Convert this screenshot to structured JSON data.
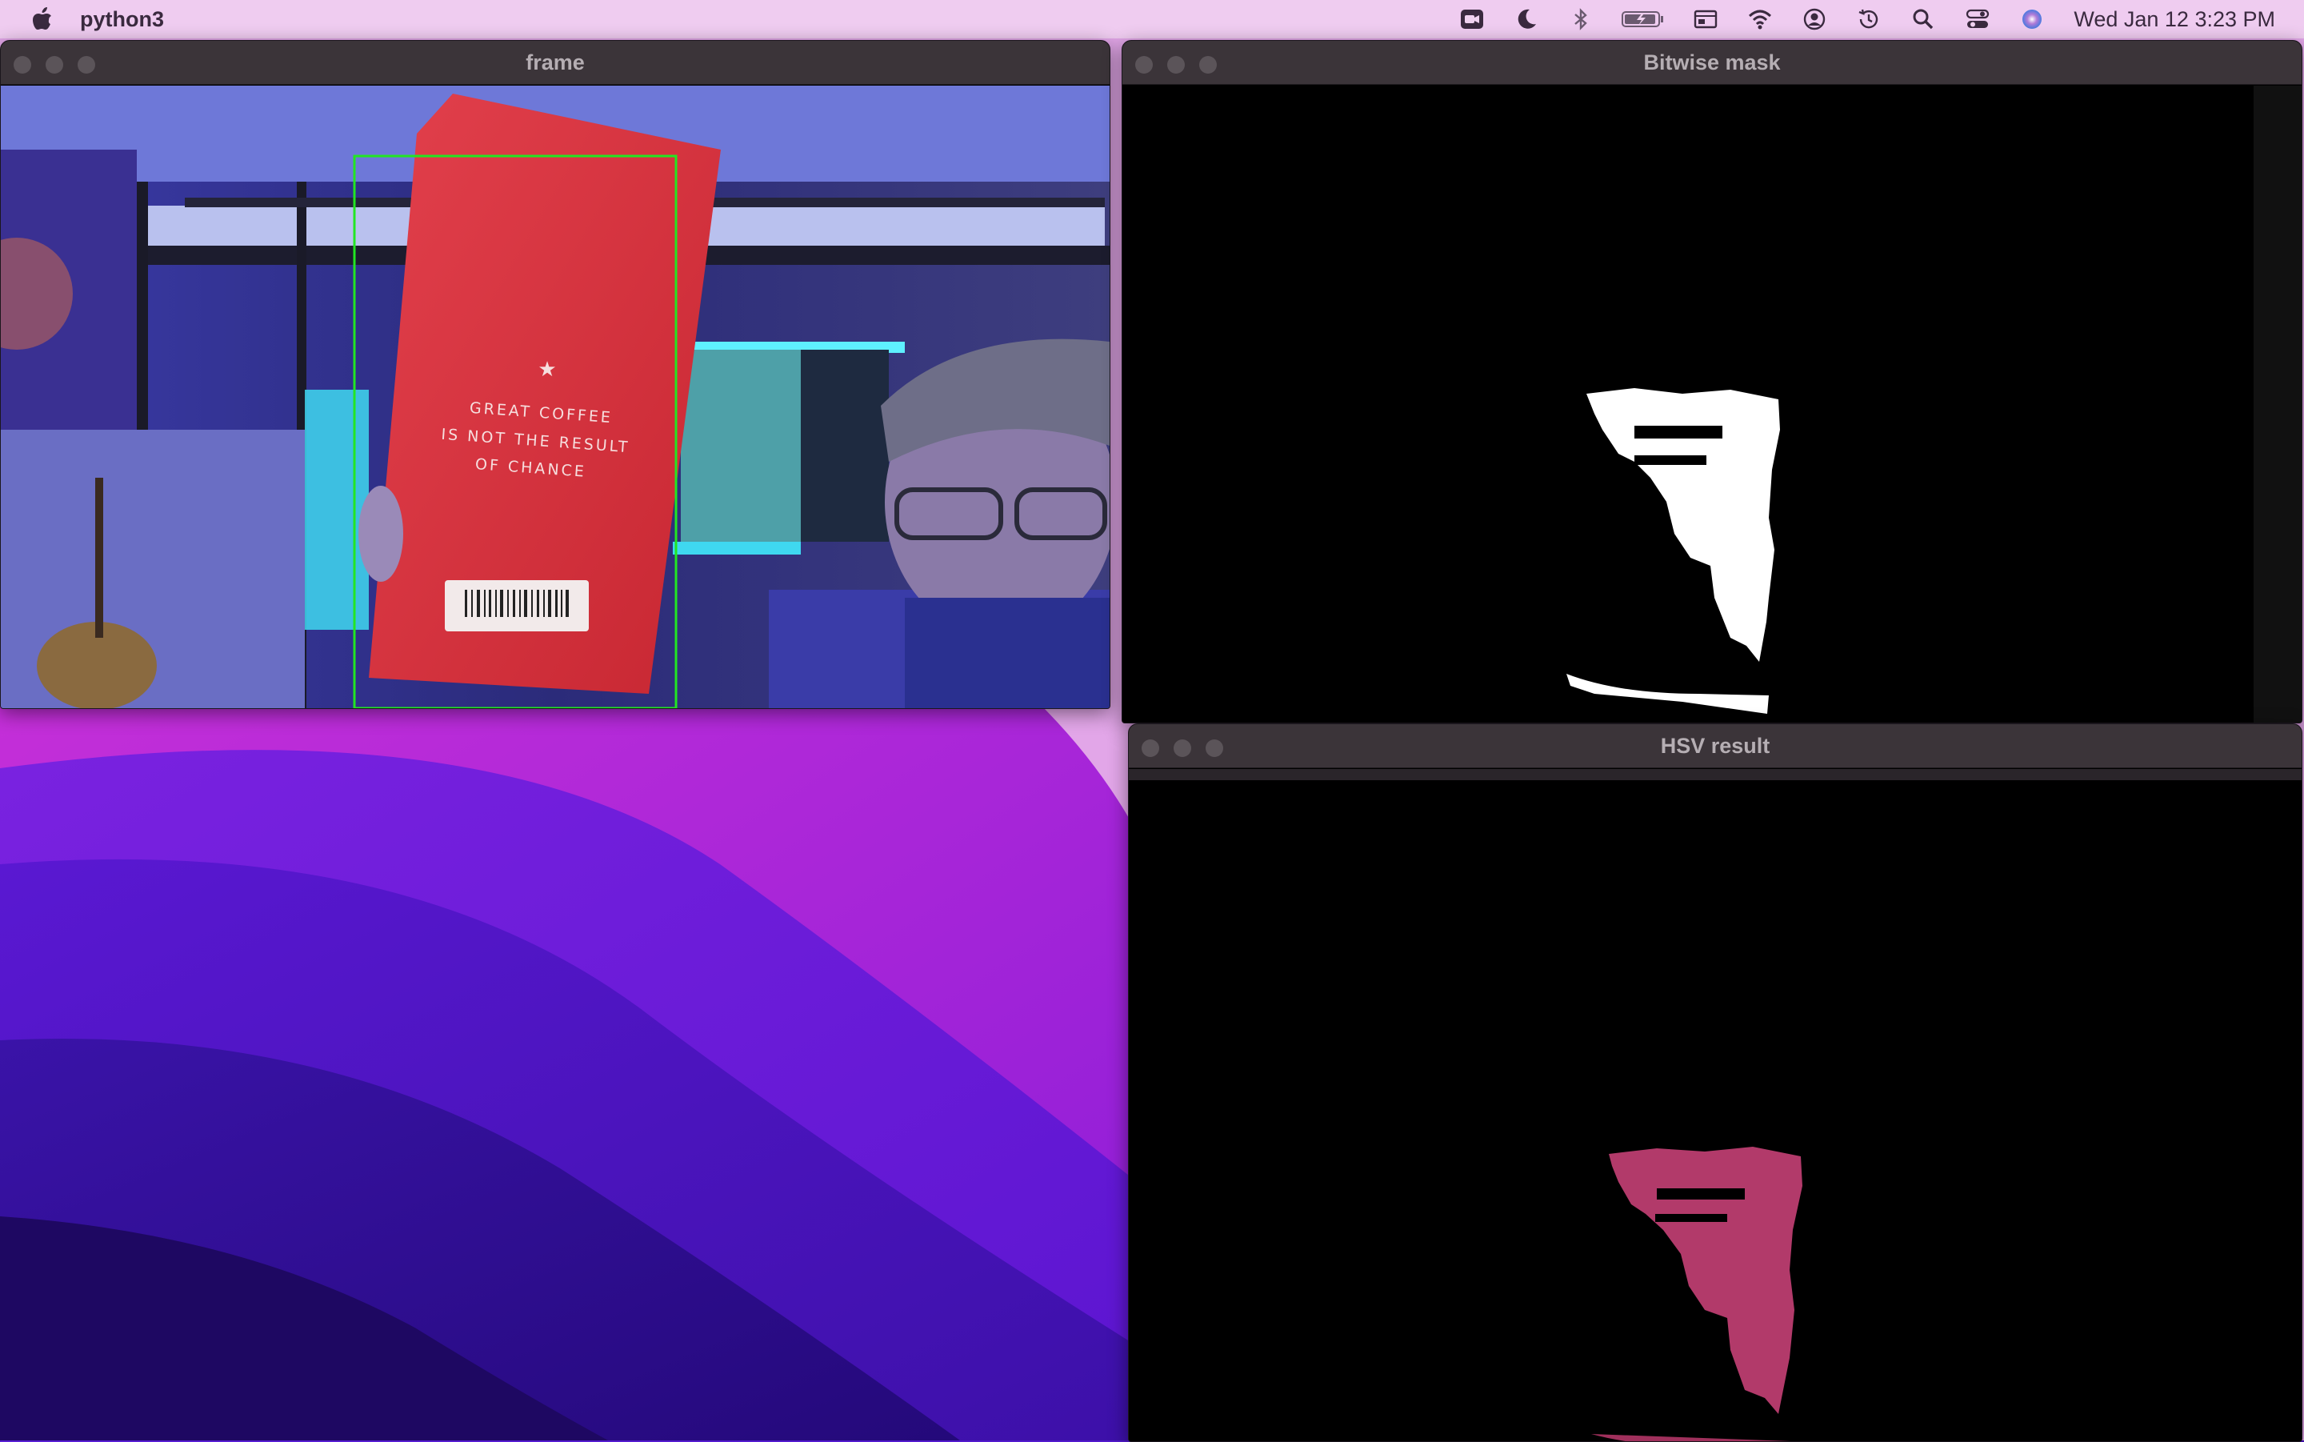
{
  "menubar": {
    "app_name": "python3",
    "clock": "Wed Jan 12  3:23 PM",
    "status_icons": [
      "video-icon",
      "moon-icon",
      "bluetooth-icon",
      "battery-icon",
      "display-icon",
      "wifi-icon",
      "user-icon",
      "time-machine-icon",
      "search-icon",
      "control-center-icon",
      "siri-icon"
    ]
  },
  "windows": {
    "frame": {
      "title": "frame"
    },
    "mask": {
      "title": "Bitwise mask"
    },
    "hsv": {
      "title": "HSV result"
    }
  },
  "camera": {
    "bag_text_line1": "GREAT COFFEE",
    "bag_text_line2": "IS NOT THE RESULT",
    "bag_text_line3": "OF CHANCE",
    "star": "★"
  },
  "colors": {
    "detection_box": "#22e622",
    "bag_red": "#d9303a",
    "hsv_pink": "#b23a6a",
    "mask_white": "#ffffff"
  }
}
